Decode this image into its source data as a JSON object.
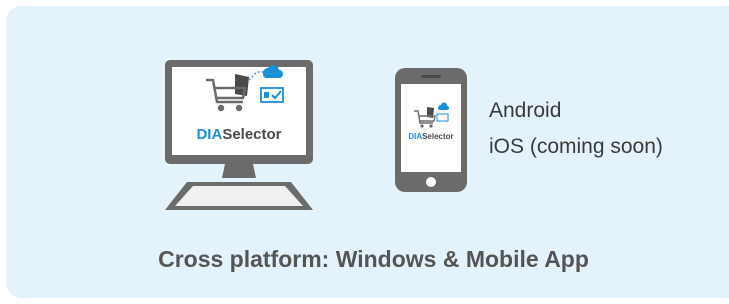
{
  "logo": {
    "prefix": "DIA",
    "suffix": "Selector",
    "prefix_color": "#1a8fd8",
    "suffix_color": "#4a4a4a"
  },
  "platforms": {
    "android_label": "Android",
    "ios_label": "iOS (coming soon)"
  },
  "headline": "Cross platform: Windows & Mobile App",
  "colors": {
    "card_background": "#e3f2fb",
    "device_gray": "#6b6b6b",
    "accent_blue": "#1a8fd8"
  },
  "icons": [
    "desktop-computer-icon",
    "smartphone-icon",
    "shopping-cart-icon",
    "cloud-icon",
    "checkbox-icon"
  ]
}
